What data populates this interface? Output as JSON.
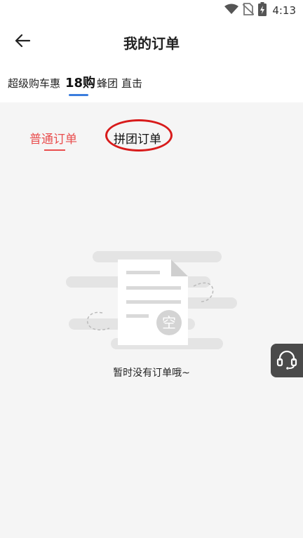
{
  "status_bar": {
    "time": "4:13",
    "icons": [
      "wifi-icon",
      "no-sim-icon",
      "battery-charging-icon"
    ]
  },
  "header": {
    "title": "我的订单",
    "back_icon": "arrow-left-icon"
  },
  "store_tabs": [
    {
      "label": "超级购车惠",
      "active": false
    },
    {
      "label": "18购",
      "active": true
    },
    {
      "label": "蜂团",
      "active": false
    },
    {
      "label": "直击",
      "active": false
    }
  ],
  "order_tabs": [
    {
      "label": "普通订单",
      "active": true
    },
    {
      "label": "拼团订单",
      "active": false,
      "highlighted": true
    }
  ],
  "empty_state": {
    "badge": "空",
    "message": "暂时没有订单哦~"
  },
  "floating": {
    "service_icon": "headset-icon"
  },
  "colors": {
    "accent_red": "#e94e4e",
    "tab_blue": "#3b7ddd",
    "highlight_ring": "#d81b1b",
    "background": "#f5f5f5"
  }
}
